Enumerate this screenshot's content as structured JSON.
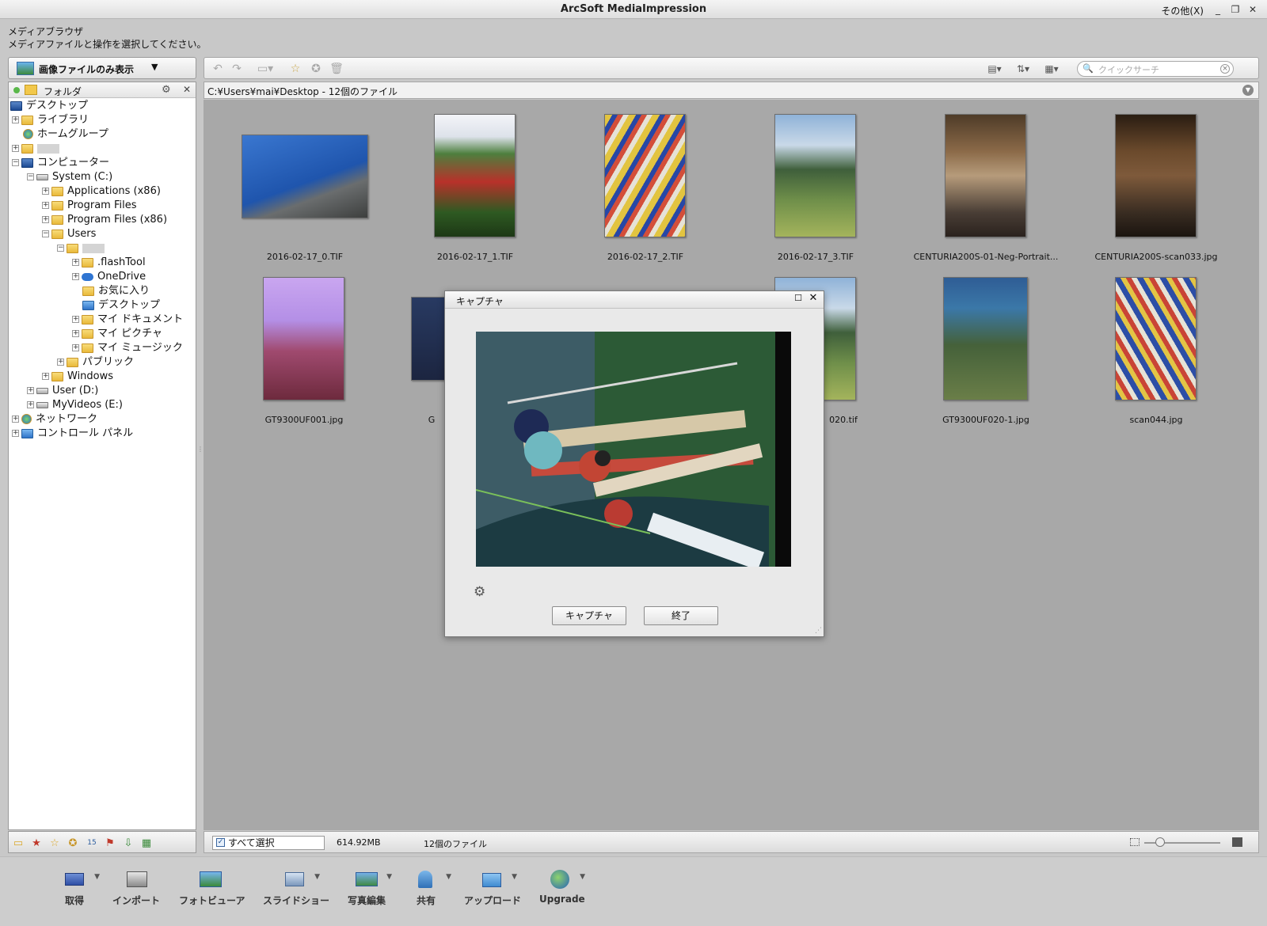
{
  "window": {
    "title": "ArcSoft MediaImpression",
    "other_menu": "その他(X)",
    "controls": {
      "minimize": "_",
      "restore": "❐",
      "close": "✕"
    }
  },
  "header": {
    "title": "メディアブラウザ",
    "subtitle": "メディアファイルと操作を選択してください。"
  },
  "left_panel": {
    "filter_label": "画像ファイルのみ表示",
    "filter_arrow": "▼",
    "tree_header": "フォルダ",
    "close_glyph": "✕",
    "gear_glyph": "⚙",
    "tree": [
      {
        "label": "デスクトップ"
      },
      {
        "label": "ライブラリ"
      },
      {
        "label": "ホームグループ"
      },
      {
        "label": ""
      },
      {
        "label": "コンピューター"
      },
      {
        "label": "System (C:)"
      },
      {
        "label": "Applications (x86)"
      },
      {
        "label": "Program Files"
      },
      {
        "label": "Program Files (x86)"
      },
      {
        "label": "Users"
      },
      {
        "label": ""
      },
      {
        "label": ".flashTool"
      },
      {
        "label": "OneDrive"
      },
      {
        "label": "お気に入り"
      },
      {
        "label": "デスクトップ"
      },
      {
        "label": "マイ ドキュメント"
      },
      {
        "label": "マイ ピクチャ"
      },
      {
        "label": "マイ ミュージック"
      },
      {
        "label": "パブリック"
      },
      {
        "label": "Windows"
      },
      {
        "label": "User (D:)"
      },
      {
        "label": "MyVideos (E:)"
      },
      {
        "label": "ネットワーク"
      },
      {
        "label": "コントロール パネル"
      }
    ]
  },
  "path": {
    "text": "C:¥Users¥mai¥Desktop - 12個のファイル"
  },
  "search": {
    "placeholder": "クイックサーチ"
  },
  "thumbnails": [
    {
      "caption": "2016-02-17_0.TIF"
    },
    {
      "caption": "2016-02-17_1.TIF"
    },
    {
      "caption": "2016-02-17_2.TIF"
    },
    {
      "caption": "2016-02-17_3.TIF"
    },
    {
      "caption": "CENTURIA200S-01-Neg-Portrait..."
    },
    {
      "caption": "CENTURIA200S-scan033.jpg"
    },
    {
      "caption": "GT9300UF001.jpg"
    },
    {
      "caption": "G"
    },
    {
      "caption": "020.tif"
    },
    {
      "caption": "GT9300UF020-1.jpg"
    },
    {
      "caption": "scan044.jpg"
    }
  ],
  "status": {
    "select_all": "すべて選択",
    "size": "614.92MB",
    "count": "12個のファイル"
  },
  "bottom_bar": [
    {
      "label": "取得",
      "icon": "scanner-icon"
    },
    {
      "label": "インポート",
      "icon": "import-icon"
    },
    {
      "label": "フォトビューア",
      "icon": "photo-viewer-icon"
    },
    {
      "label": "スライドショー",
      "icon": "slideshow-icon"
    },
    {
      "label": "写真編集",
      "icon": "photo-edit-icon"
    },
    {
      "label": "共有",
      "icon": "share-icon"
    },
    {
      "label": "アップロード",
      "icon": "upload-icon"
    },
    {
      "label": "Upgrade",
      "icon": "globe-icon"
    }
  ],
  "modal": {
    "title": "キャプチャ",
    "capture_button": "キャプチャ",
    "close_button": "終了"
  },
  "colors": {
    "content_bg": "#a8a8a8",
    "accent_blue": "#2e73c8",
    "folder_yellow": "#f2c84b"
  }
}
